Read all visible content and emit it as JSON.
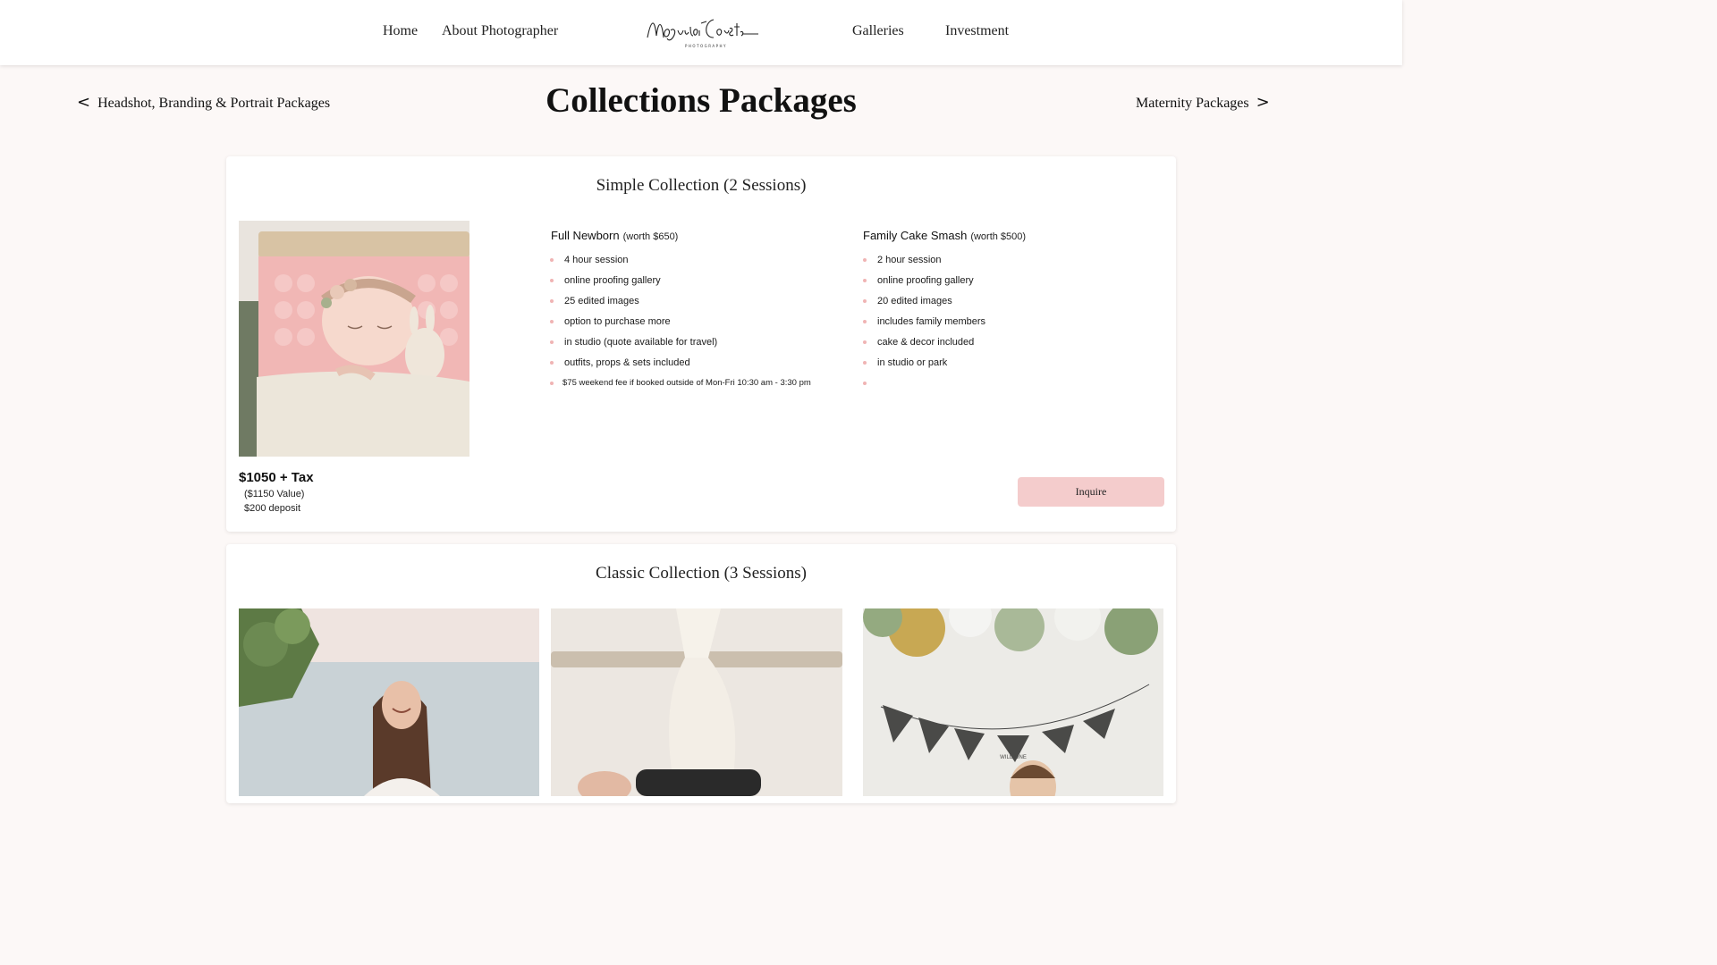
{
  "header": {
    "nav_left": [
      "Home",
      "About Photographer"
    ],
    "nav_right": [
      "Galleries",
      "Investment"
    ],
    "logo_text": "Magnolia Coasts",
    "logo_sub": "PHOTOGRAPHY"
  },
  "page": {
    "title": "Collections Packages",
    "prev_link": "Headshot, Branding & Portrait Packages",
    "next_link": "Maternity Packages",
    "prev_arrow": "<",
    "next_arrow": ">"
  },
  "simple": {
    "title": "Simple Collection (2 Sessions)",
    "col1": {
      "name": "Full Newborn",
      "worth": "(worth $650)",
      "items": [
        "4 hour session",
        "online proofing gallery",
        "25 edited images",
        "option to purchase more",
        "in studio (quote available for travel)",
        "outfits, props & sets included",
        "$75 weekend fee if booked outside of Mon-Fri 10:30 am - 3:30 pm"
      ]
    },
    "col2": {
      "name": "Family Cake Smash",
      "worth": "(worth $500)",
      "items": [
        "2 hour session",
        "online proofing gallery",
        "20 edited images",
        "includes family members",
        "cake & decor included",
        "in studio or park",
        ""
      ]
    },
    "price": "$1050 + Tax",
    "value": "($1150 Value)",
    "deposit": "$200 deposit",
    "inquire_label": "Inquire"
  },
  "classic": {
    "title": "Classic Collection (3 Sessions)",
    "banner_text": "WILD ONE"
  },
  "colors": {
    "accent_pink": "#f4cccc",
    "bullet_pink": "#f0b4b4",
    "page_bg": "#fcf8f7"
  }
}
